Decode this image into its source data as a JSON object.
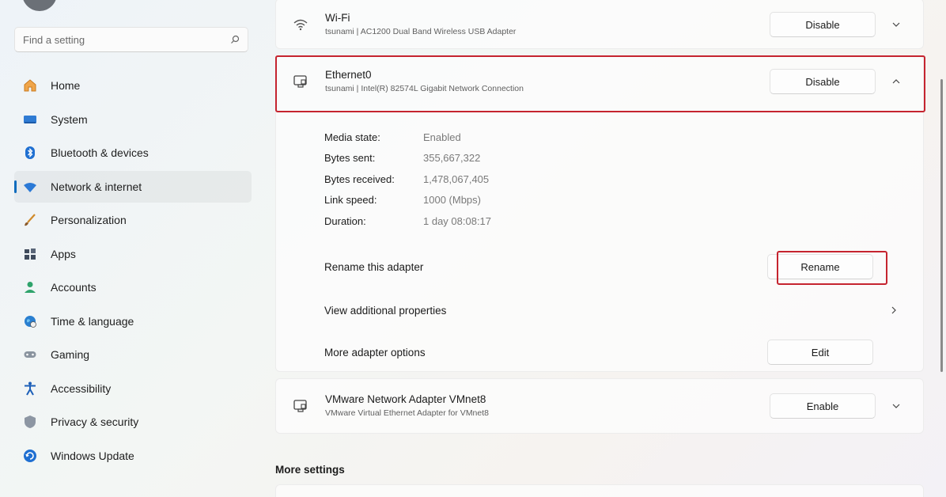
{
  "search": {
    "placeholder": "Find a setting"
  },
  "sidebar": {
    "items": [
      {
        "label": "Home",
        "icon": "home-icon",
        "active": false
      },
      {
        "label": "System",
        "icon": "system-icon",
        "active": false
      },
      {
        "label": "Bluetooth & devices",
        "icon": "bluetooth-icon",
        "active": false
      },
      {
        "label": "Network & internet",
        "icon": "network-icon",
        "active": true
      },
      {
        "label": "Personalization",
        "icon": "brush-icon",
        "active": false
      },
      {
        "label": "Apps",
        "icon": "apps-icon",
        "active": false
      },
      {
        "label": "Accounts",
        "icon": "accounts-icon",
        "active": false
      },
      {
        "label": "Time & language",
        "icon": "globe-clock-icon",
        "active": false
      },
      {
        "label": "Gaming",
        "icon": "gamepad-icon",
        "active": false
      },
      {
        "label": "Accessibility",
        "icon": "accessibility-icon",
        "active": false
      },
      {
        "label": "Privacy & security",
        "icon": "shield-icon",
        "active": false
      },
      {
        "label": "Windows Update",
        "icon": "update-icon",
        "active": false
      }
    ]
  },
  "adapters": {
    "wifi": {
      "name": "Wi-Fi",
      "desc": "tsunami | AC1200 Dual Band Wireless USB Adapter",
      "button": "Disable"
    },
    "ethernet": {
      "name": "Ethernet0",
      "desc": "tsunami | Intel(R) 82574L Gigabit Network Connection",
      "button": "Disable",
      "details": [
        {
          "label": "Media state:",
          "value": "Enabled"
        },
        {
          "label": "Bytes sent:",
          "value": "355,667,322"
        },
        {
          "label": "Bytes received:",
          "value": "1,478,067,405"
        },
        {
          "label": "Link speed:",
          "value": "1000 (Mbps)"
        },
        {
          "label": "Duration:",
          "value": "1 day 08:08:17"
        }
      ],
      "rename_label": "Rename this adapter",
      "rename_button": "Rename",
      "view_props_label": "View additional properties",
      "more_options_label": "More adapter options",
      "edit_button": "Edit"
    },
    "vmware": {
      "name": "VMware Network Adapter VMnet8",
      "desc": "VMware Virtual Ethernet Adapter for VMnet8",
      "button": "Enable"
    }
  },
  "more_settings": "More settings",
  "colors": {
    "accent": "#0f6cbd",
    "highlight": "#c5242f"
  }
}
